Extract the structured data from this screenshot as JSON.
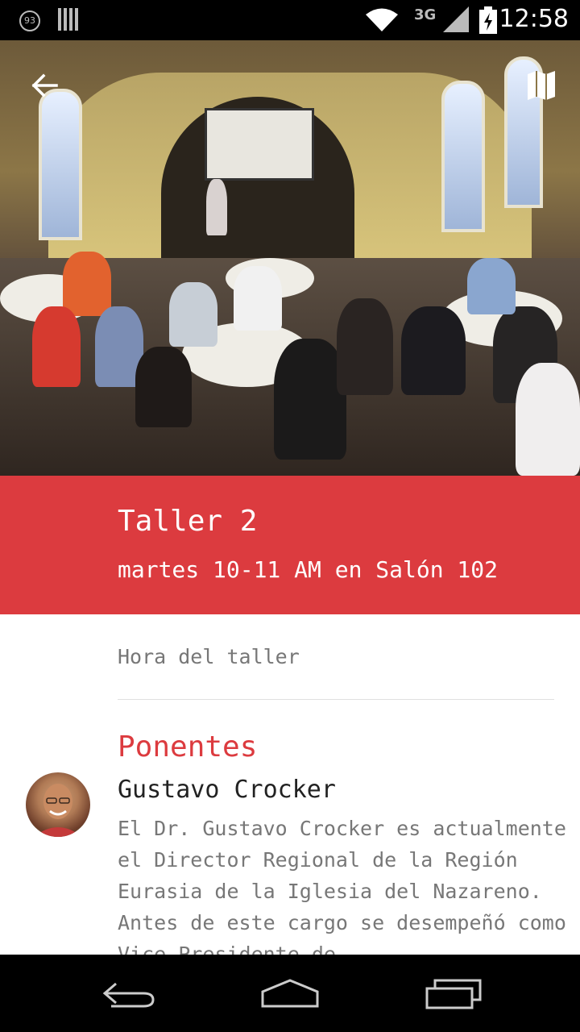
{
  "status_bar": {
    "notification_count": "93",
    "network": "3G",
    "time": "12:58"
  },
  "hero": {
    "back_icon": "arrow-left-icon",
    "map_icon": "map-icon"
  },
  "header": {
    "title": "Taller 2",
    "subtitle": "martes 10-11 AM en Salón 102",
    "background_color": "#dc3b3f"
  },
  "content": {
    "hora_label": "Hora del taller",
    "speakers_heading": "Ponentes",
    "speakers": [
      {
        "name": "Gustavo Crocker",
        "bio": "El Dr. Gustavo Crocker es actualmente el Director Regional de la Región Eurasia de la Iglesia del Nazareno. Antes de este cargo se desempeñó como Vice Presidente de"
      }
    ]
  },
  "nav_bar": {
    "back_icon": "nav-back-icon",
    "home_icon": "nav-home-icon",
    "recents_icon": "nav-recents-icon"
  }
}
